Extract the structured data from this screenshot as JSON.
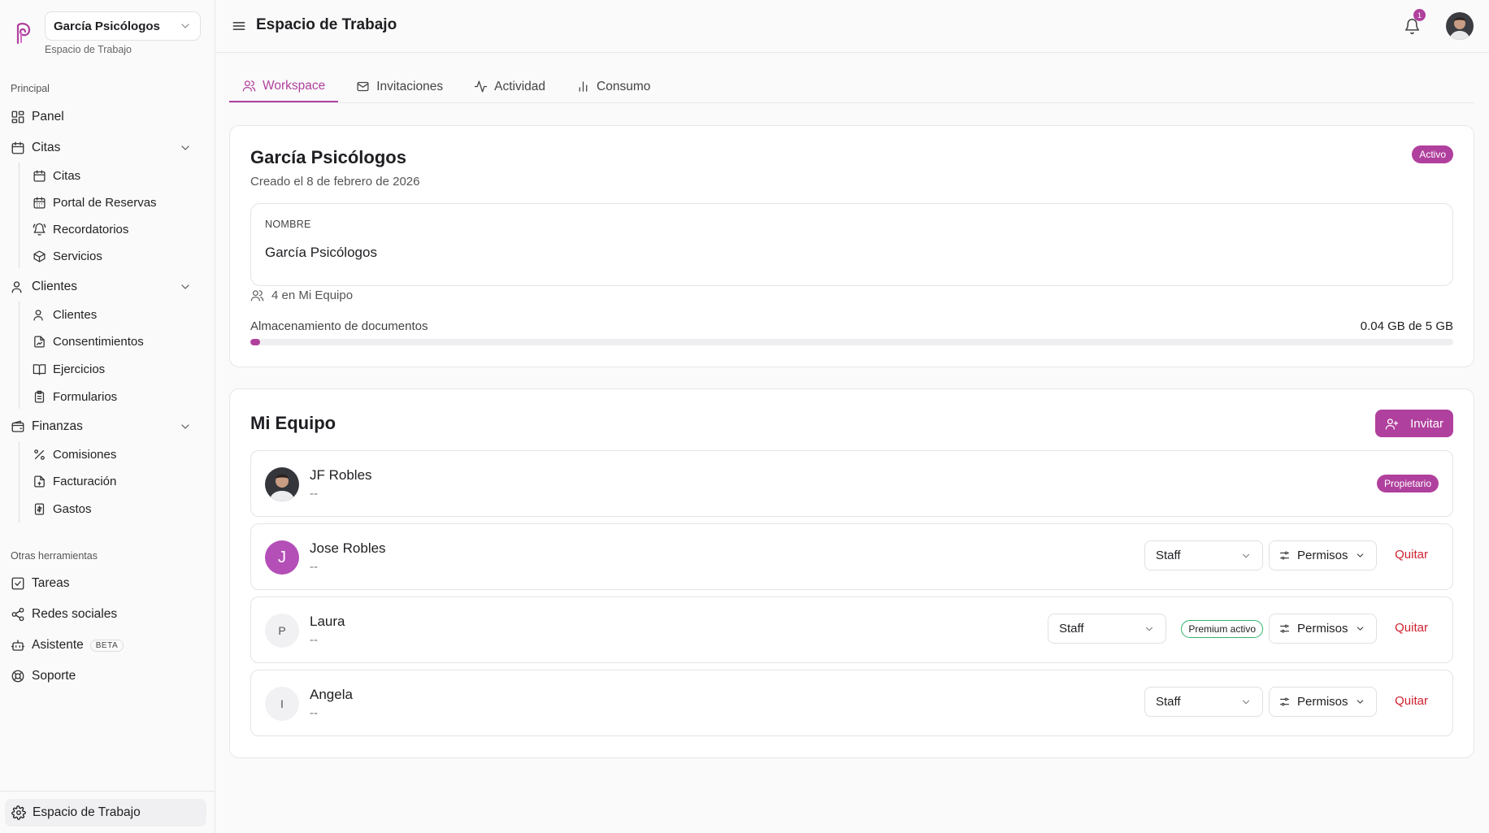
{
  "sidebar": {
    "workspace_select": "García Psicólogos",
    "workspace_sub": "Espacio de Trabajo",
    "section_principal": "Principal",
    "section_otras": "Otras herramientas",
    "panel": "Panel",
    "citas": "Citas",
    "citas_items": [
      "Citas",
      "Portal de Reservas",
      "Recordatorios",
      "Servicios"
    ],
    "clientes": "Clientes",
    "clientes_items": [
      "Clientes",
      "Consentimientos",
      "Ejercicios",
      "Formularios"
    ],
    "finanzas": "Finanzas",
    "finanzas_items": [
      "Comisiones",
      "Facturación",
      "Gastos"
    ],
    "tareas": "Tareas",
    "redes": "Redes sociales",
    "asistente": "Asistente",
    "asistente_badge": "BETA",
    "soporte": "Soporte",
    "bottom": "Espacio de Trabajo"
  },
  "header": {
    "title": "Espacio de Trabajo",
    "notifications": "1"
  },
  "tabs": [
    "Workspace",
    "Invitaciones",
    "Actividad",
    "Consumo"
  ],
  "workspace": {
    "name": "García Psicólogos",
    "created": "Creado el 8 de febrero de 2026",
    "status": "Activo",
    "field_label": "NOMBRE",
    "field_value": "García Psicólogos",
    "team_count": "4 en Mi Equipo",
    "storage_label": "Almacenamiento de documentos",
    "storage_value": "0.04 GB de 5 GB",
    "storage_fraction": 0.008
  },
  "team": {
    "title": "Mi Equipo",
    "invite": "Invitar",
    "members": [
      {
        "name": "JF Robles",
        "sub": "--",
        "badge": "Propietario"
      },
      {
        "name": "Jose Robles",
        "sub": "--",
        "initial": "J",
        "role": "Staff",
        "permisos": "Permisos",
        "quitar": "Quitar"
      },
      {
        "name": "Laura",
        "sub": "--",
        "initial": "P",
        "role": "Staff",
        "premium": "Premium activo",
        "permisos": "Permisos",
        "quitar": "Quitar"
      },
      {
        "name": "Angela",
        "sub": "--",
        "initial": "I",
        "role": "Staff",
        "permisos": "Permisos",
        "quitar": "Quitar"
      }
    ]
  },
  "colors": {
    "accent": "#b0409d",
    "danger": "#d0202e",
    "premium_border": "#2fb36a"
  }
}
